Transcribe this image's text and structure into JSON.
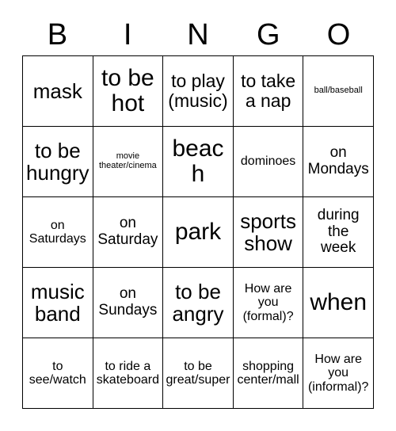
{
  "card": {
    "title": "BINGO",
    "header_letters": [
      "B",
      "I",
      "N",
      "G",
      "O"
    ],
    "rows": [
      [
        {
          "text": "mask",
          "size": "xl"
        },
        {
          "text": "to be\nhot",
          "size": "xxl"
        },
        {
          "text": "to play\n(music)",
          "size": "lg"
        },
        {
          "text": "to take\na nap",
          "size": "lg"
        },
        {
          "text": "ball/baseball",
          "size": "xxs"
        }
      ],
      [
        {
          "text": "to be\nhungry",
          "size": "xl"
        },
        {
          "text": "movie\ntheater/cinema",
          "size": "xxs"
        },
        {
          "text": "beach",
          "size": "xxl"
        },
        {
          "text": "dominoes",
          "size": "sm"
        },
        {
          "text": "on\nMondays",
          "size": "md"
        }
      ],
      [
        {
          "text": "on\nSaturdays",
          "size": "sm"
        },
        {
          "text": "on\nSaturday",
          "size": "md"
        },
        {
          "text": "park",
          "size": "xxl"
        },
        {
          "text": "sports\nshow",
          "size": "xl"
        },
        {
          "text": "during\nthe\nweek",
          "size": "md"
        }
      ],
      [
        {
          "text": "music\nband",
          "size": "xl"
        },
        {
          "text": "on\nSundays",
          "size": "md"
        },
        {
          "text": "to be\nangry",
          "size": "xl"
        },
        {
          "text": "How are\nyou\n(formal)?",
          "size": "sm"
        },
        {
          "text": "when",
          "size": "xxl"
        }
      ],
      [
        {
          "text": "to\nsee/watch",
          "size": "sm"
        },
        {
          "text": "to ride a\nskateboard",
          "size": "sm"
        },
        {
          "text": "to be\ngreat/super",
          "size": "sm"
        },
        {
          "text": "shopping\ncenter/mall",
          "size": "sm"
        },
        {
          "text": "How are\nyou\n(informal)?",
          "size": "sm"
        }
      ]
    ]
  },
  "colors": {
    "background": "#ffffff",
    "text": "#000000",
    "border": "#000000"
  }
}
